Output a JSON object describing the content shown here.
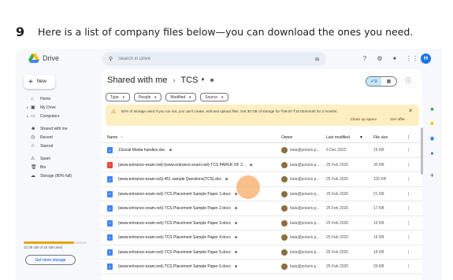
{
  "step": {
    "number": "9",
    "text": "Here is a list of company files below—you can download the ones you need."
  },
  "app": {
    "name": "Drive"
  },
  "search": {
    "placeholder": "Search in Drive"
  },
  "topbar_icons": [
    "help-icon",
    "settings-icon",
    "gemini-icon",
    "apps-grid-icon"
  ],
  "user_initial": "H",
  "sidebar": {
    "new_label": "New",
    "items": [
      {
        "label": "Home",
        "icon": "home-icon"
      },
      {
        "label": "My Drive",
        "icon": "drive-icon"
      },
      {
        "label": "Computers",
        "icon": "computer-icon"
      },
      {
        "label": "Shared with me",
        "icon": "people-icon"
      },
      {
        "label": "Recent",
        "icon": "clock-icon"
      },
      {
        "label": "Starred",
        "icon": "star-icon"
      },
      {
        "label": "Spam",
        "icon": "spam-icon"
      },
      {
        "label": "Bin",
        "icon": "bin-icon"
      },
      {
        "label": "Storage (80% full)",
        "icon": "cloud-icon"
      }
    ],
    "storage_used_fraction": 0.8,
    "storage_text": "12.3b GB of 15 GB used",
    "get_storage": "Get more storage"
  },
  "breadcrumb": {
    "root": "Shared with me",
    "current": "TCS"
  },
  "filters": [
    "Type",
    "People",
    "Modified",
    "Source"
  ],
  "banner": {
    "message": "82% of storage used If you run out, you can't create, edit and upload files. Get 30 GB of storage for ₹49.00 ₹15.00/month for 2 months.",
    "action_clean": "Clean up space",
    "action_offer": "Get offer",
    "color": "#feefc3"
  },
  "columns": {
    "name": "Name",
    "owner": "Owner",
    "modified": "Last modified",
    "size": "File size"
  },
  "files": [
    {
      "name": "1Social Media handles.doc",
      "shared": "true",
      "owner": "bala@polaris.p...",
      "modified": "6 Dec 2022",
      "size": "15 KB",
      "type": "doc"
    },
    {
      "name": "{www.entrance-exam.net}-{www.entrance-exam.net}-TCS PAPER OF 2...",
      "shared": "true",
      "owner": "bala@polaris.p...",
      "modified": "25 Feb 2020",
      "size": "30 KB",
      "type": "pdf"
    },
    {
      "name": "{www.entrance-exam.net}-451 sample Questions(TCS).doc",
      "shared": "true",
      "owner": "bala@polaris.p...",
      "modified": "25 Feb 2020",
      "size": "116 KB",
      "type": "doc"
    },
    {
      "name": "{www.entrance-exam.net}-TCS Placement Sample Paper 1.docx",
      "shared": "true",
      "owner": "bala@polaris.p...",
      "modified": "25 Feb 2020",
      "size": "21 KB",
      "type": "doc"
    },
    {
      "name": "{www.entrance-exam.net}-TCS Placement Sample Paper 2.docx",
      "shared": "true",
      "owner": "bala@polaris.p...",
      "modified": "25 Feb 2020",
      "size": "17 KB",
      "type": "doc"
    },
    {
      "name": "{www.entrance-exam.net}-TCS Placement Sample Paper 3.docx",
      "shared": "true",
      "owner": "bala@polaris.p...",
      "modified": "25 Feb 2020",
      "size": "16 KB",
      "type": "doc"
    },
    {
      "name": "{www.entrance-exam.net}-TCS Placement Sample Paper 4.docx",
      "shared": "true",
      "owner": "bala@polaris.p...",
      "modified": "25 Feb 2020",
      "size": "16 KB",
      "type": "doc"
    },
    {
      "name": "{www.entrance-exam.net}-TCS Placement Sample Paper 5.docx",
      "shared": "true",
      "owner": "bala@polaris.p...",
      "modified": "25 Feb 2020",
      "size": "15 KB",
      "type": "doc"
    },
    {
      "name": "{www.entrance-exam.net}-TCS Placement Sample Paper 6.docx",
      "shared": "true",
      "owner": "bala@polaris.p...",
      "modified": "25 Feb 2020",
      "size": "20 KB",
      "type": "doc"
    }
  ],
  "colors": {
    "doc": "#4285f4",
    "pdf": "#ea4335",
    "accent": "#0b57d0"
  }
}
